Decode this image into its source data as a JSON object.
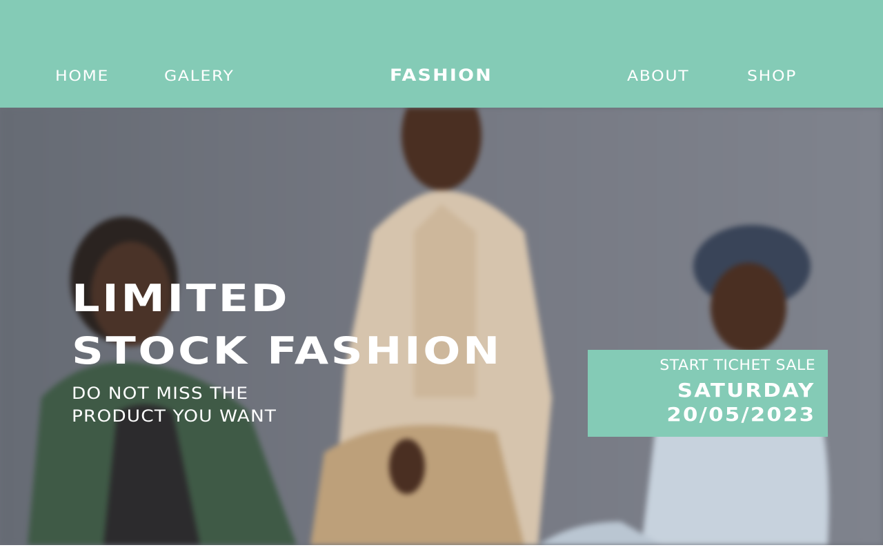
{
  "nav": {
    "home": "HOME",
    "galery": "GALERY",
    "brand": "FASHION",
    "about": "ABOUT",
    "shop": "SHOP"
  },
  "hero": {
    "headline_line1": "LIMITED",
    "headline_line2": "STOCK FASHION",
    "subline_line1": "DO NOT MISS THE",
    "subline_line2": "PRODUCT YOU WANT",
    "ticket": {
      "label": "START TICHET SALE",
      "day": "SATURDAY",
      "date": "20/05/2023"
    }
  },
  "colors": {
    "accent": "#84cbb6",
    "text": "#ffffff",
    "hero_background": "#6b6f78"
  }
}
